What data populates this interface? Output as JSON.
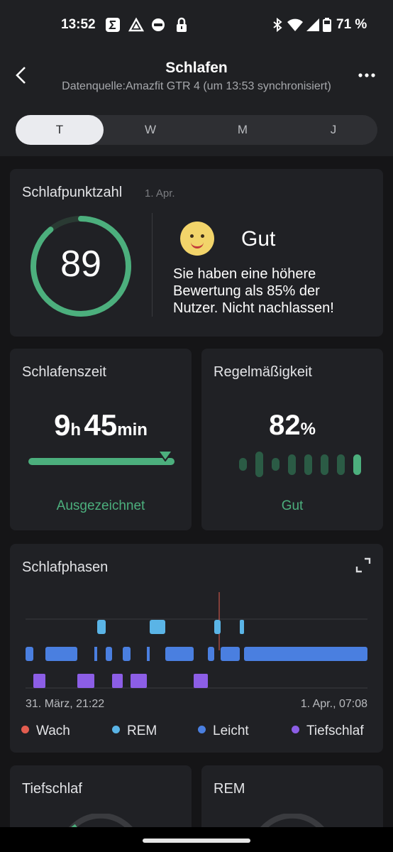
{
  "status": {
    "time": "13:52",
    "battery": "71 %",
    "notif_icons": [
      "sigma-icon",
      "drive-icon",
      "ring-icon",
      "lock-icon"
    ]
  },
  "header": {
    "title": "Schlafen",
    "subtitle": "Datenquelle:Amazfit GTR 4 (um 13:53 synchronisiert)"
  },
  "tabs": [
    "T",
    "W",
    "M",
    "J"
  ],
  "active_tab": "T",
  "score": {
    "title": "Schlafpunktzahl",
    "date": "1. Apr.",
    "value": "89",
    "progress": 0.89,
    "emoji": "🙂",
    "rating": "Gut",
    "description_lines": [
      "Sie haben eine höhere",
      "Bewertung als 85% der",
      "Nutzer. Nicht nachlassen!"
    ]
  },
  "sleeptime": {
    "title": "Schlafenszeit",
    "hours": "9",
    "hours_unit": "h",
    "minutes": "45",
    "minutes_unit": "min",
    "status": "Ausgezeichnet"
  },
  "regularity": {
    "title": "Regelmäßigkeit",
    "value": "82",
    "unit": "%",
    "status": "Gut",
    "bars": [
      0.45,
      0.9,
      0.45,
      0.72,
      0.72,
      0.72,
      0.72,
      0.72
    ]
  },
  "phases": {
    "title": "Schlafphasen",
    "start_label": "31. März, 21:22",
    "end_label": "1. Apr., 07:08",
    "legend": [
      {
        "label": "Wach",
        "color": "#e35d50"
      },
      {
        "label": "REM",
        "color": "#5ab4e6"
      },
      {
        "label": "Leicht",
        "color": "#4a7fe0"
      },
      {
        "label": "Tiefschlaf",
        "color": "#8c5ee6"
      }
    ]
  },
  "bottom_cards": [
    {
      "title": "Tiefschlaf"
    },
    {
      "title": "REM"
    }
  ]
}
